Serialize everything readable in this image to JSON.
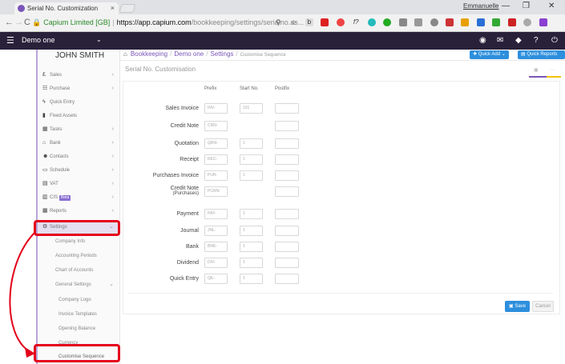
{
  "browser": {
    "tab_title": "Serial No. Customization",
    "tab_close": "×",
    "profile": "Emmanuelle",
    "url_secure": "Capium Limited [GB]",
    "url_host": "https://app.capium.com",
    "url_path": "/bookkeeping/settings/serialno.as...",
    "win_min": "—",
    "win_max": "❐",
    "win_close": "✕"
  },
  "appbar": {
    "company": "Demo one"
  },
  "sidebar": {
    "user": "JOHN SMITH",
    "items": [
      {
        "label": "Sales",
        "icon": "£"
      },
      {
        "label": "Purchase",
        "icon": "☷"
      },
      {
        "label": "Quick Entry",
        "icon": "ϟ"
      },
      {
        "label": "Fixed Assets",
        "icon": "▮"
      },
      {
        "label": "Tasks",
        "icon": "▦"
      },
      {
        "label": "Bank",
        "icon": "⌂"
      },
      {
        "label": "Contacts",
        "icon": "☻"
      },
      {
        "label": "Schedule",
        "icon": "▭"
      },
      {
        "label": "VAT",
        "icon": "▤"
      },
      {
        "label": "CIS",
        "icon": "▥",
        "badge": "Beta"
      },
      {
        "label": "Reports",
        "icon": "▦"
      },
      {
        "label": "Settings",
        "icon": "⚙"
      }
    ],
    "settings_sub": [
      "Company Info",
      "Accounting Periods",
      "Chart of Accounts",
      "General Settings"
    ],
    "general_sub": [
      "Company Logo",
      "Invoice Templates",
      "Opening Balance",
      "Currency",
      "Customise Sequence"
    ]
  },
  "breadcrumb": {
    "home_icon": "home-icon",
    "bookkeeping": "Bookkeeping",
    "company": "Demo one",
    "settings": "Settings",
    "current": "Customise Sequence"
  },
  "actions": {
    "quick_add": "Quick Add",
    "quick_reports": "Quick Reports"
  },
  "page": {
    "title": "Serial No. Customisation"
  },
  "form": {
    "col_prefix": "Prefix",
    "col_start": "Start No.",
    "col_postfix": "Postfix",
    "rows": [
      {
        "label": "Sales Invoice",
        "prefix": "INV-",
        "start": "101",
        "show_start": true
      },
      {
        "label": "Credit Note",
        "prefix": "CRN-",
        "start": "",
        "show_start": false
      },
      {
        "label": "Quotation",
        "prefix": "QRN-",
        "start": "1",
        "show_start": true
      },
      {
        "label": "Receipt",
        "prefix": "REC-",
        "start": "1",
        "show_start": true
      },
      {
        "label": "Purchases Invoice",
        "prefix": "PUR-",
        "start": "1",
        "show_start": true
      },
      {
        "label": "Credit Note",
        "label2": "(Purchases)",
        "prefix": "PCRN-",
        "start": "",
        "show_start": false
      },
      {
        "label": "Payment",
        "prefix": "PAY-",
        "start": "1",
        "show_start": true
      },
      {
        "label": "Journal",
        "prefix": "JNL-",
        "start": "1",
        "show_start": true
      },
      {
        "label": "Bank",
        "prefix": "BNK-",
        "start": "1",
        "show_start": true
      },
      {
        "label": "Dividend",
        "prefix": "DIV-",
        "start": "1",
        "show_start": true
      },
      {
        "label": "Quick Entry",
        "prefix": "QE-",
        "start": "1",
        "show_start": true
      }
    ],
    "save": "Save",
    "cancel": "Cancel"
  },
  "colors": {
    "appbar": "#29213a",
    "accent": "#7a56b9",
    "button": "#2d8fdd",
    "highlight": "#e4001b"
  }
}
